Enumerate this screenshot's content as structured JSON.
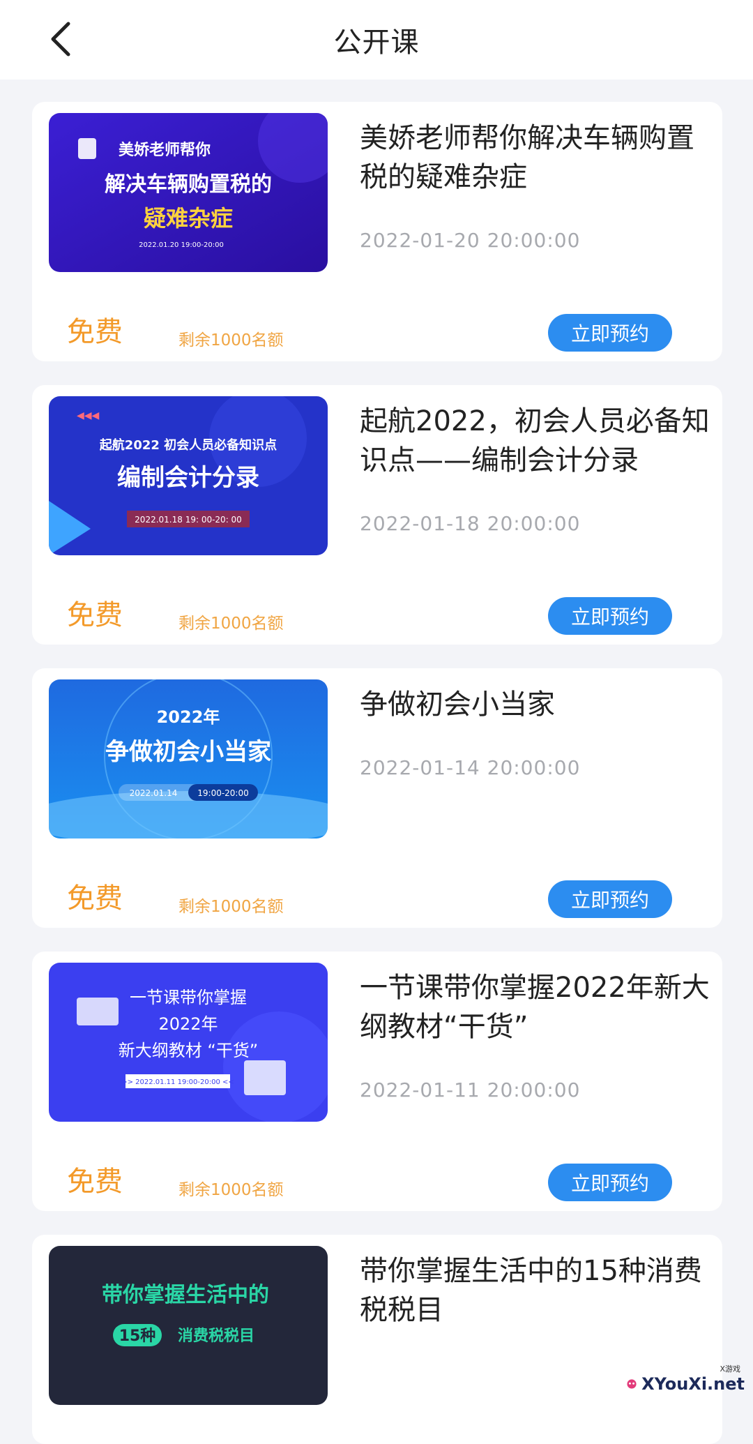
{
  "header": {
    "title": "公开课"
  },
  "courses": [
    {
      "title": "美娇老师帮你解决车辆购置税的疑难杂症",
      "time": "2022-01-20 20:00:00",
      "price": "免费",
      "remaining": "剩余1000名额",
      "button": "立即预约",
      "thumb": {
        "line1": "美娇老师帮你",
        "line2": "解决车辆购置税的",
        "line3": "疑难杂症",
        "line4": "2022.01.20 19:00-20:00"
      }
    },
    {
      "title": "起航2022，初会人员必备知识点——编制会计分录",
      "time": "2022-01-18 20:00:00",
      "price": "免费",
      "remaining": "剩余1000名额",
      "button": "立即预约",
      "thumb": {
        "line0": "◀◀◀",
        "line1": "起航2022 初会人员必备知识点",
        "line2": "编制会计分录",
        "line3": "2022.01.18  19: 00-20: 00"
      }
    },
    {
      "title": "争做初会小当家",
      "time": "2022-01-14 20:00:00",
      "price": "免费",
      "remaining": "剩余1000名额",
      "button": "立即预约",
      "thumb": {
        "line1": "2022年",
        "line2": "争做初会小当家",
        "line3a": "2022.01.14",
        "line3b": "19:00-20:00"
      }
    },
    {
      "title": "一节课带你掌握2022年新大纲教材“干货”",
      "time": "2022-01-11 20:00:00",
      "price": "免费",
      "remaining": "剩余1000名额",
      "button": "立即预约",
      "thumb": {
        "line1": "一节课带你掌握",
        "line2": "2022年",
        "line3": "新大纲教材 “干货”",
        "line4": ">> 2022.01.11 19:00-20:00 <<"
      }
    },
    {
      "title": "带你掌握生活中的15种消费税税目",
      "thumb": {
        "line1": "带你掌握生活中的",
        "line2a": "15种",
        "line2b": "消费税税目"
      }
    }
  ],
  "watermark": {
    "text": "XYouXi.net",
    "small": "X游戏"
  },
  "colors": {
    "accent": "#2c8df0",
    "price": "#f39a2a",
    "background": "#f3f4f8"
  }
}
